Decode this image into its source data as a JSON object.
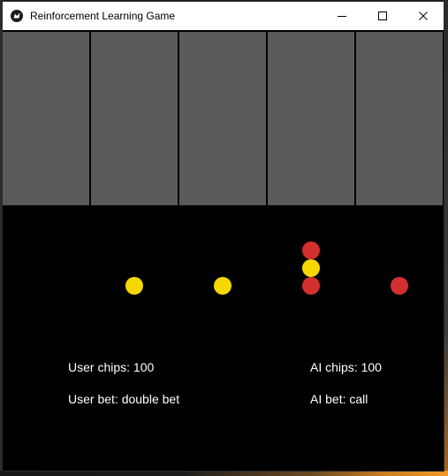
{
  "window": {
    "title": "Reinforcement Learning Game"
  },
  "icons": {
    "app": "kivy-app-icon",
    "minimize": "minimize-icon",
    "maximize": "maximize-icon",
    "close": "close-icon"
  },
  "colors": {
    "card_back": "#5a5a5a",
    "background": "#000000",
    "chip_yellow": "#f5d800",
    "chip_red": "#d32f2f",
    "text": "#ffffff"
  },
  "cards": {
    "count": 5,
    "face": "back"
  },
  "chips": {
    "columns": [
      {
        "stack": [
          "yellow"
        ]
      },
      {
        "stack": [
          "yellow"
        ]
      },
      {
        "stack": [
          "red",
          "yellow",
          "red"
        ]
      },
      {
        "stack": [
          "red"
        ]
      }
    ]
  },
  "user": {
    "chips_text": "User chips: 100",
    "bet_text": "User bet: double bet"
  },
  "ai": {
    "chips_text": "AI chips: 100",
    "bet_text": "AI bet: call"
  }
}
